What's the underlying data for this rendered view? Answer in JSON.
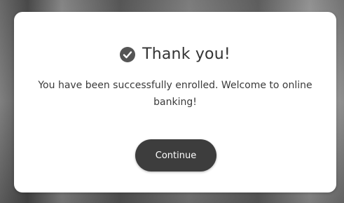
{
  "dialog": {
    "title": "Thank you!",
    "icon": "check-circle-icon",
    "message": "You have been successfully enrolled. Welcome to online banking!",
    "continue_label": "Continue"
  },
  "colors": {
    "button_background": "#3d3d3d",
    "button_text": "#ffffff",
    "icon": "#555555",
    "text": "#333333"
  }
}
